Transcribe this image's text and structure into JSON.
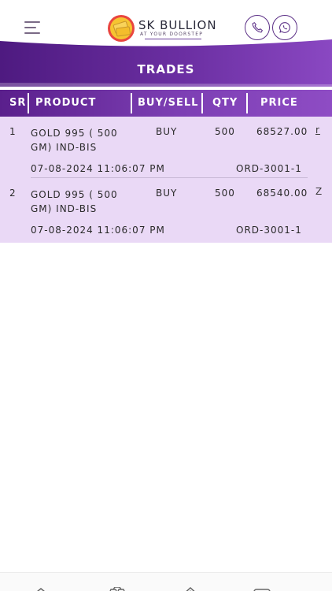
{
  "header": {
    "brand": "SK BULLION",
    "tagline": "AT YOUR DOORSTEP"
  },
  "banner": {
    "title": "TRADES"
  },
  "table": {
    "columns": [
      "SR",
      "PRODUCT",
      "BUY/SELL",
      "QTY",
      "PRICE"
    ],
    "rows": [
      {
        "sr": "1",
        "product": "GOLD 995 ( 500 GM) IND-BIS",
        "side": "BUY",
        "qty": "500",
        "price": "68527.00",
        "date": "07-08-2024 11:06:07 PM",
        "order": "ORD-3001-1",
        "more": "r"
      },
      {
        "sr": "2",
        "product": "GOLD 995 ( 500 GM) IND-BIS",
        "side": "BUY",
        "qty": "500",
        "price": "68540.00",
        "date": "07-08-2024 11:06:07 PM",
        "order": "ORD-3001-1",
        "more": "Z"
      }
    ]
  },
  "icons": {
    "menu": "hamburger-menu-icon",
    "call": "phone-icon",
    "whatsapp": "whatsapp-icon"
  },
  "colors": {
    "primary_purple": "#5a1f8c",
    "row_background": "#ead9f6",
    "accent_gold": "#f2c12e"
  }
}
